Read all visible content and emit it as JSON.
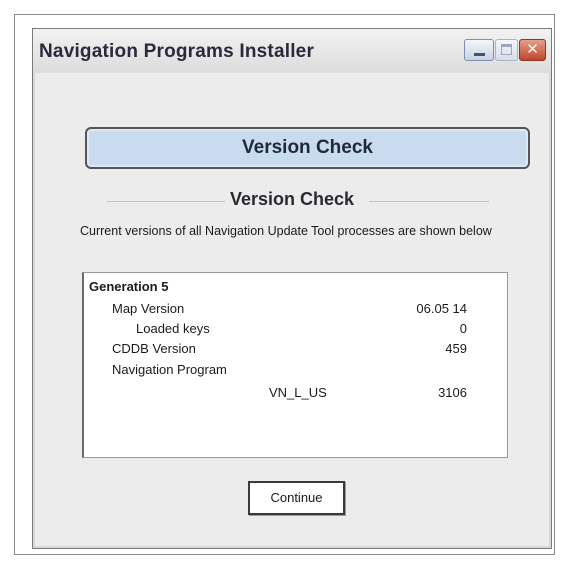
{
  "window": {
    "title": "Navigation Programs Installer",
    "close_glyph": "✕"
  },
  "header_banner": "Version Check",
  "section_title": "Version Check",
  "description": "Current versions of all Navigation Update Tool processes are shown below",
  "versions": {
    "group": "Generation 5",
    "rows": [
      {
        "label": "Map Version",
        "value": "06.05 14"
      },
      {
        "label": "Loaded keys",
        "value": "0"
      },
      {
        "label": "CDDB Version",
        "value": "459"
      },
      {
        "label": "Navigation Program",
        "value": ""
      },
      {
        "label": "VN_L_US",
        "value": "3106"
      }
    ]
  },
  "buttons": {
    "continue": "Continue"
  },
  "icons": [
    "minimize-icon",
    "maximize-icon",
    "close-icon"
  ],
  "colors": {
    "banner": "#c9dbee",
    "close_button": "#c0462c",
    "window_bg": "#ececec"
  }
}
